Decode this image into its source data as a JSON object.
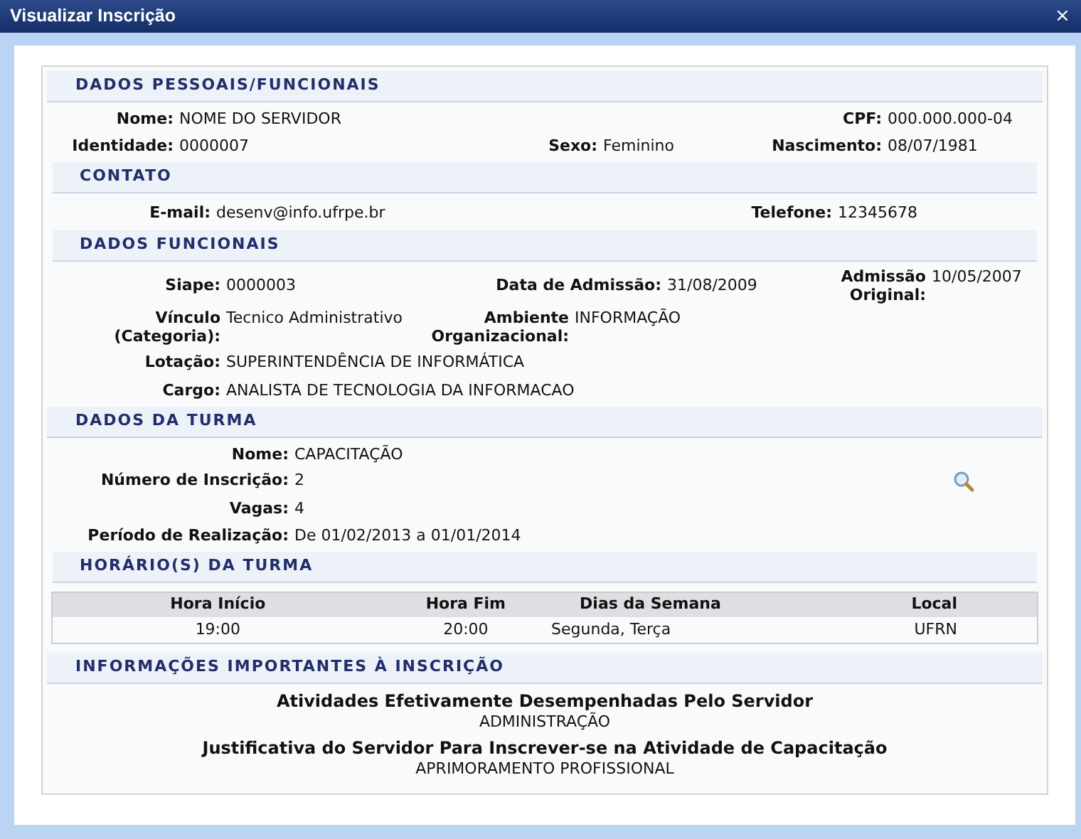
{
  "window": {
    "title": "Visualizar Inscrição",
    "close": "×"
  },
  "sections": [
    {
      "kind": "personal",
      "title": "DADOS PESSOAIS/FUNCIONAIS",
      "rows": [
        [
          {
            "label": "Nome:",
            "value": "NOME DO SERVIDOR"
          },
          "",
          {
            "label": "CPF:",
            "value": "000.000.000-04"
          }
        ],
        [
          {
            "label": "Identidade:",
            "value": "0000007"
          },
          {
            "label": "Sexo:",
            "value": "Feminino"
          },
          {
            "label": "Nascimento:",
            "value": "08/07/1981"
          }
        ]
      ]
    },
    {
      "kind": "contact",
      "title": "CONTATO",
      "rows": [
        [
          {
            "label": "E-mail:",
            "value": "desenv@info.ufrpe.br"
          },
          {
            "label": "Telefone:",
            "value": "12345678"
          }
        ]
      ]
    },
    {
      "kind": "functional",
      "title": "DADOS FUNCIONAIS",
      "rows": [
        [
          {
            "label": "Siape:",
            "value": "0000003"
          },
          {
            "label": "Data de Admissão:",
            "value": "31/08/2009"
          },
          {
            "label": "Admissão Original:",
            "value": "10/05/2007"
          }
        ],
        [
          {
            "label": "Vínculo (Categoria):",
            "value": "Tecnico Administrativo"
          },
          {
            "label": "Ambiente Organizacional:",
            "value": "INFORMAÇÃO"
          }
        ],
        [
          {
            "label": "Lotação:",
            "value": "SUPERINTENDÊNCIA DE INFORMÁTICA"
          }
        ],
        [
          {
            "label": "Cargo:",
            "value": "ANALISTA DE TECNOLOGIA DA INFORMACAO"
          }
        ]
      ]
    },
    {
      "kind": "class",
      "title": "DADOS DA TURMA",
      "rows": [
        [
          {
            "label": "Nome:",
            "value": "CAPACITAÇÃO"
          }
        ],
        [
          {
            "label": "Número de Inscrição:",
            "value": "2",
            "has_lookup": true
          }
        ],
        [
          {
            "label": "Vagas:",
            "value": "4"
          }
        ],
        [
          {
            "label": "Período de Realização:",
            "value": "De 01/02/2013 a 01/01/2014"
          }
        ]
      ]
    },
    {
      "kind": "table",
      "title": "HORÁRIO(S) DA TURMA",
      "columns": [
        "Hora Início",
        "Hora Fim",
        "Dias da Semana",
        "Local"
      ],
      "rows": [
        [
          "19:00",
          "20:00",
          "Segunda, Terça",
          "UFRN"
        ]
      ]
    },
    {
      "kind": "info",
      "title": "INFORMAÇÕES IMPORTANTES À INSCRIÇÃO",
      "items": [
        {
          "heading": "Atividades Efetivamente Desempenhadas Pelo Servidor",
          "value": "ADMINISTRAÇÃO"
        },
        {
          "heading": "Justificativa do Servidor Para Inscrever-se na Atividade de Capacitação",
          "value": "APRIMORAMENTO PROFISSIONAL"
        }
      ]
    }
  ]
}
